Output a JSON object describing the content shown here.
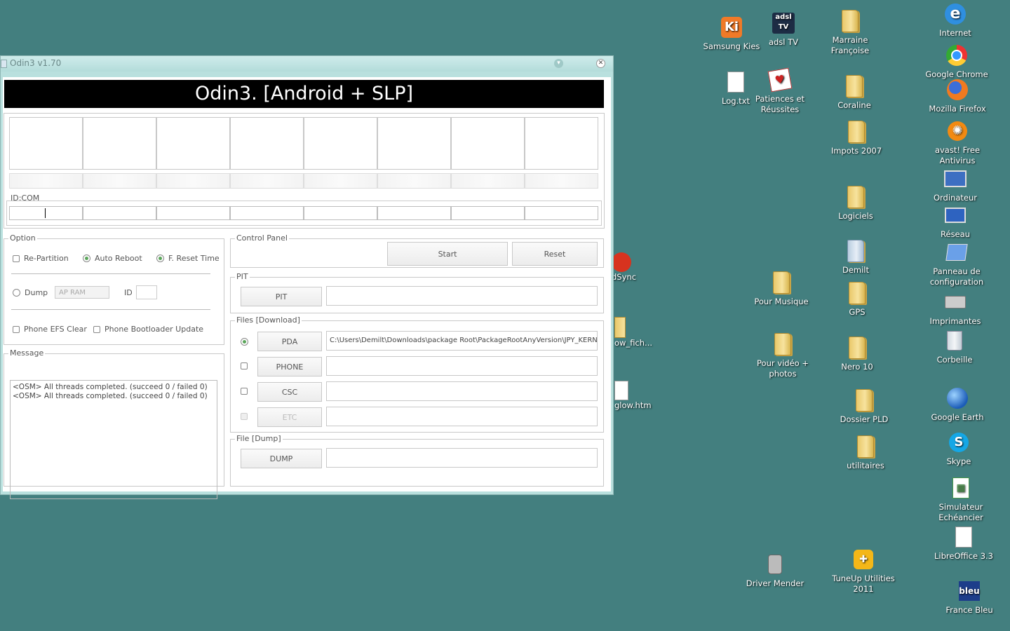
{
  "window": {
    "title": "Odin3 v1.70",
    "banner": "Odin3. [Android + SLP]",
    "id_com_label": "ID:COM",
    "option": {
      "label": "Option",
      "re_partition": "Re-Partition",
      "auto_reboot": "Auto Reboot",
      "f_reset_time": "F. Reset Time",
      "dump": "Dump",
      "dump_select": "AP RAM",
      "id_label": "ID",
      "phone_efs_clear": "Phone EFS Clear",
      "phone_bootloader_update": "Phone Bootloader Update"
    },
    "control_panel": {
      "label": "Control Panel",
      "start": "Start",
      "reset": "Reset"
    },
    "pit": {
      "label": "PIT",
      "button": "PIT",
      "path": ""
    },
    "files_download": {
      "label": "Files [Download]",
      "pda": "PDA",
      "pda_path": "C:\\Users\\Demilt\\Downloads\\package Root\\PackageRootAnyVersion\\JPY_KERNE",
      "phone": "PHONE",
      "csc": "CSC",
      "etc": "ETC"
    },
    "file_dump": {
      "label": "File [Dump]",
      "button": "DUMP"
    },
    "message": {
      "label": "Message",
      "lines": [
        "<OSM> All threads completed. (succeed 0 / failed 0)",
        "<OSM> All threads completed. (succeed 0 / failed 0)"
      ]
    }
  },
  "desktop": {
    "icons": {
      "samsung_kies": "Samsung Kies",
      "adsl_tv": "adsl TV",
      "marraine": "Marraine Françoise",
      "internet": "Internet",
      "log_txt": "Log.txt",
      "patiences": "Patiences et Réussites",
      "coraline": "Coraline",
      "google_chrome": "Google Chrome",
      "mozilla_firefox": "Mozilla Firefox",
      "impots": "Impots 2007",
      "avast": "avast! Free Antivirus",
      "logiciels": "Logiciels",
      "ordinateur": "Ordinateur",
      "reseau": "Réseau",
      "demilt": "Demilt",
      "panneau": "Panneau de configuration",
      "pour_musique": "Pour Musique",
      "gps": "GPS",
      "imprimantes": "Imprimantes",
      "pour_video": "Pour vidéo + photos",
      "nero": "Nero 10",
      "corbeille": "Corbeille",
      "dossier_pld": "Dossier PLD",
      "google_earth": "Google Earth",
      "utilitaires": "utilitaires",
      "skype": "Skype",
      "simulateur": "Simulateur Echéancier",
      "libreoffice": "LibreOffice 3.3",
      "driver_mender": "Driver Mender",
      "tuneup": "TuneUp Utilities 2011",
      "france_bleu": "France Bleu"
    },
    "partial": {
      "dsync": "dSync",
      "ow_fich": "ow_fich...",
      "glow_htm": "glow.htm"
    }
  }
}
